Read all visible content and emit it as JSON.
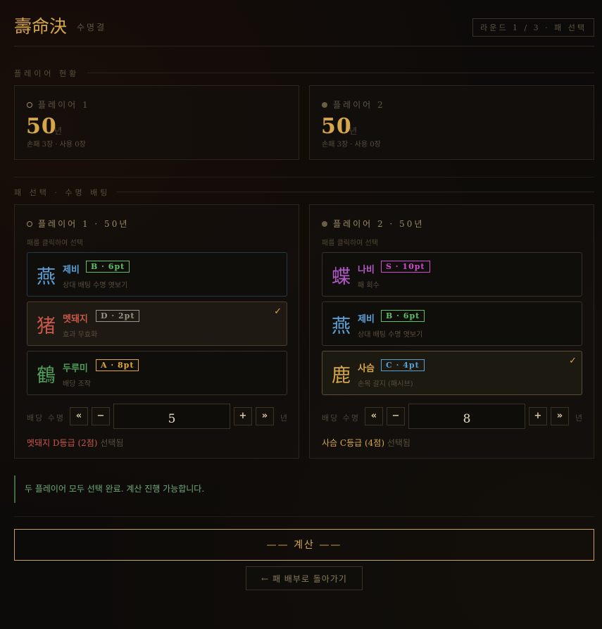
{
  "header": {
    "title": "壽命決",
    "subtitle": "수명결",
    "round_badge": "라운드 1 / 3 · 패 선택"
  },
  "sections": {
    "status": "플레이어 현황",
    "select": "패 선택 · 수명 배팅"
  },
  "status": [
    {
      "name": "플레이어 1",
      "years": "50",
      "unit": "년",
      "cards": "손패 3장 · 사용 0장"
    },
    {
      "name": "플레이어 2",
      "years": "50",
      "unit": "년",
      "cards": "손패 3장 · 사용 0장"
    }
  ],
  "players": [
    {
      "head": "플레이어 1 · 50년",
      "hint": "패를 클릭하여 선택",
      "cards": [
        {
          "glyph": "燕",
          "name": "제비",
          "grade": "B · 6pt",
          "desc": "상대 배팅 수명 엿보기",
          "color": "#5aa0d8",
          "grade_color": "#5fbf6a",
          "selected": false
        },
        {
          "glyph": "猪",
          "name": "멧돼지",
          "grade": "D · 2pt",
          "desc": "효과 무효화",
          "color": "#c8584a",
          "grade_color": "#9a9488",
          "selected": true,
          "check": "✓"
        },
        {
          "glyph": "鶴",
          "name": "두루미",
          "grade": "A · 8pt",
          "desc": "배당 조작",
          "color": "#4f9e5a",
          "grade_color": "#e0a83a",
          "selected": false
        }
      ],
      "bet": {
        "label": "배당 수명",
        "value": "5",
        "unit": "년",
        "btn_dec_big": "«",
        "btn_dec": "−",
        "btn_inc": "+",
        "btn_inc_big": "»"
      },
      "summary_highlight": "멧돼지 D등급 (2점)",
      "summary_rest": " 선택됨",
      "summary_color": "#c8584a"
    },
    {
      "head": "플레이어 2 · 50년",
      "hint": "패를 클릭하여 선택",
      "cards": [
        {
          "glyph": "蝶",
          "name": "나비",
          "grade": "S · 10pt",
          "desc": "패 회수",
          "color": "#b05ac8",
          "grade_color": "#d04ad0",
          "selected": false
        },
        {
          "glyph": "燕",
          "name": "제비",
          "grade": "B · 6pt",
          "desc": "상대 배팅 수명 엿보기",
          "color": "#5aa0d8",
          "grade_color": "#5fbf6a",
          "selected": false
        },
        {
          "glyph": "鹿",
          "name": "사슴",
          "grade": "C · 4pt",
          "desc": "손목 갈지 (패시브)",
          "color": "#d6a64a",
          "grade_color": "#5aa0d8",
          "selected": true,
          "check": "✓"
        }
      ],
      "bet": {
        "label": "배당 수명",
        "value": "8",
        "unit": "년",
        "btn_dec_big": "«",
        "btn_dec": "−",
        "btn_inc": "+",
        "btn_inc_big": "»"
      },
      "summary_highlight": "사슴 C등급 (4점)",
      "summary_rest": " 선택됨",
      "summary_color": "#d6a64a"
    }
  ],
  "notice": "두 플레이어 모두 선택 완료. 계산 진행 가능합니다.",
  "calc_button": "—— 계산 ——",
  "back_button": "← 패 배부로 돌아가기",
  "colors": {
    "accent": "#d6a64a",
    "notice": "#6fa878"
  }
}
